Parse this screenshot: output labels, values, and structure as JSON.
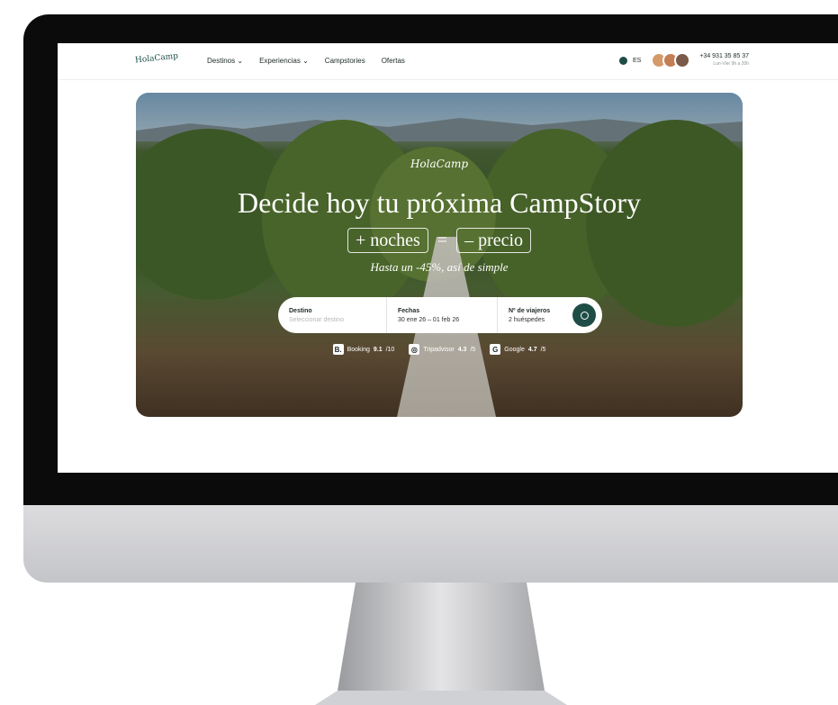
{
  "nav": {
    "logo": "HolaCamp",
    "items": [
      "Destinos ⌄",
      "Experiencias ⌄",
      "Campstories",
      "Ofertas"
    ],
    "language": "ES",
    "phone": "+34 931 35 85 37",
    "phone_note": "Lun-Vier 9h a 20h"
  },
  "hero": {
    "logo": "HolaCamp",
    "headline": "Decide hoy tu próxima CampStory",
    "formula_left": "+ noches",
    "formula_eq": "=",
    "formula_right": "– precio",
    "subtitle": "Hasta un -45%, así de simple",
    "search": {
      "destino_label": "Destino",
      "destino_placeholder": "Seleccionar destino",
      "fechas_label": "Fechas",
      "fechas_value": "30 ene 26 – 01 feb 26",
      "viajeros_label": "Nº de viajeros",
      "viajeros_value": "2 huéspedes"
    },
    "ratings": [
      {
        "badge": "B.",
        "name": "Booking",
        "score": "9.1",
        "max": "/10"
      },
      {
        "badge": "◎",
        "name": "Tripadvisor",
        "score": "4.3",
        "max": "/5"
      },
      {
        "badge": "G",
        "name": "Google",
        "score": "4.7",
        "max": "/5"
      }
    ]
  },
  "colors": {
    "brand": "#1e4d47",
    "bezel": "#0b0b0b"
  }
}
